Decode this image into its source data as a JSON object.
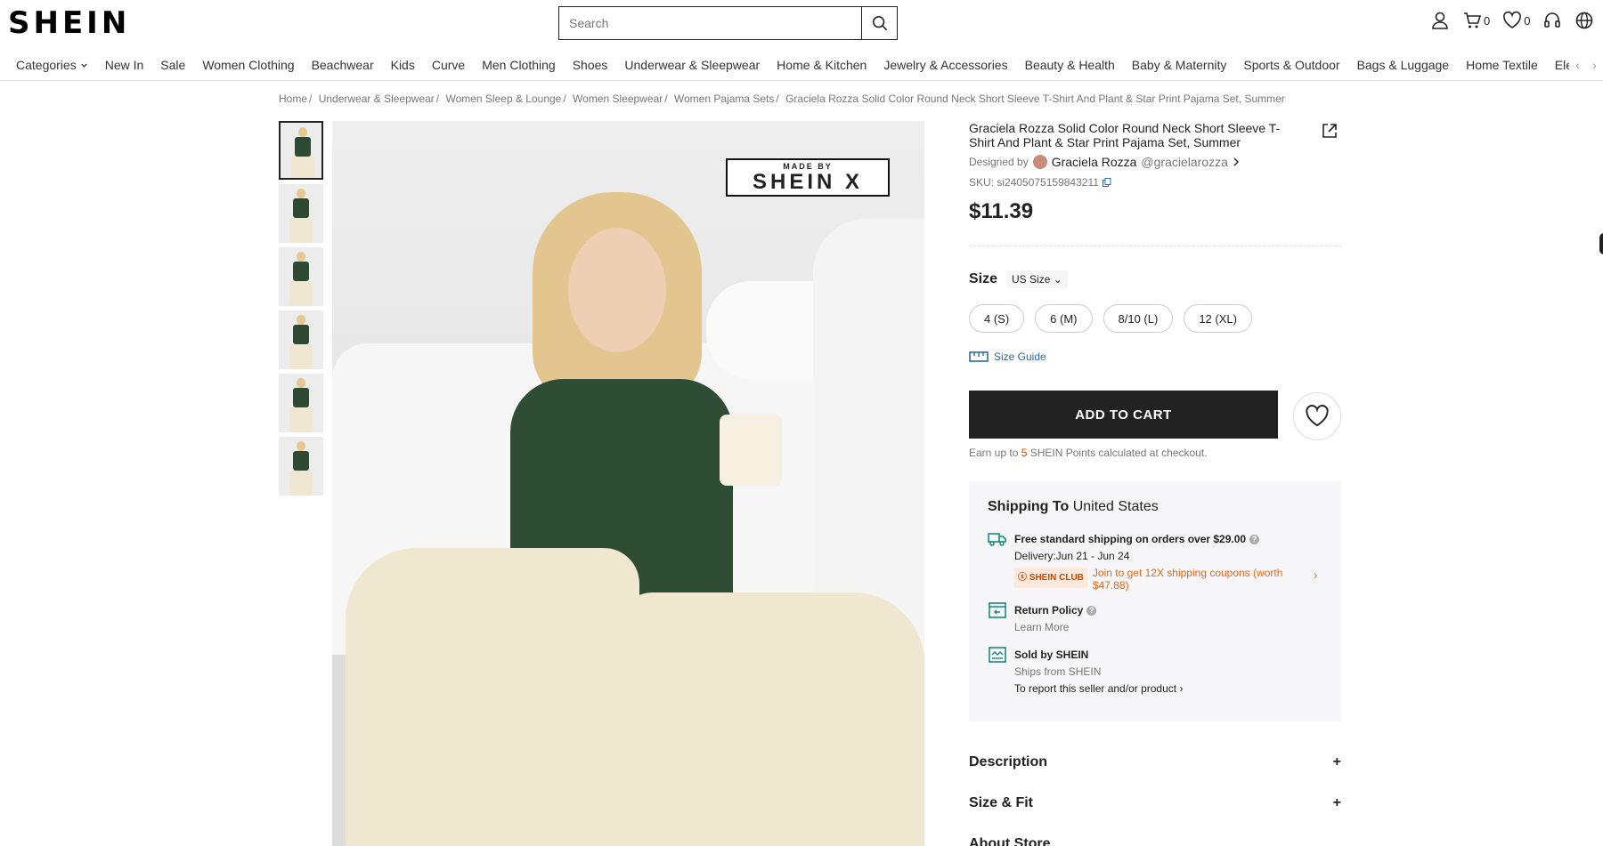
{
  "header": {
    "logo": "SHEIN",
    "search_placeholder": "Search",
    "cart_count": "0",
    "wishlist_count": "0"
  },
  "nav": {
    "items": [
      "Categories",
      "New In",
      "Sale",
      "Women Clothing",
      "Beachwear",
      "Kids",
      "Curve",
      "Men Clothing",
      "Shoes",
      "Underwear & Sleepwear",
      "Home & Kitchen",
      "Jewelry & Accessories",
      "Beauty & Health",
      "Baby & Maternity",
      "Sports & Outdoor",
      "Bags & Luggage",
      "Home Textile",
      "Electronic"
    ]
  },
  "breadcrumb": [
    "Home",
    "Underwear & Sleepwear",
    "Women Sleep & Lounge",
    "Women Sleepwear",
    "Women Pajama Sets",
    "Graciela Rozza Solid Color Round Neck Short Sleeve T-Shirt And Plant & Star Print Pajama Set, Summer"
  ],
  "gallery": {
    "thumb_count": 6,
    "badge_line1": "MADE BY",
    "badge_line2": "SHEIN X"
  },
  "product": {
    "title": "Graciela Rozza Solid Color Round Neck Short Sleeve T-Shirt And Plant & Star Print Pajama Set, Summer",
    "designed_by_label": "Designed by",
    "designer_name": "Graciela Rozza",
    "designer_handle": "@gracielarozza",
    "sku": "SKU: si2405075159843211",
    "price": "$11.39",
    "size_label": "Size",
    "size_system": "US Size",
    "sizes": [
      "4 (S)",
      "6 (M)",
      "8/10 (L)",
      "12 (XL)"
    ],
    "size_guide": "Size Guide",
    "add_to_cart": "ADD TO CART",
    "points_prefix": "Earn up to ",
    "points_value": "5",
    "points_suffix": " SHEIN Points calculated at checkout."
  },
  "shipping": {
    "title_bold": "Shipping To",
    "country": "United States",
    "free_shipping": "Free standard shipping on orders over $29.00",
    "delivery": "Delivery:Jun 21 - Jun 24",
    "club_tag": "SHEIN CLUB",
    "club_text": "Join to get 12X shipping coupons (worth $47.88)",
    "return_policy": "Return Policy",
    "learn_more": "Learn More",
    "sold_by": "Sold by SHEIN",
    "ships_from": "Ships from SHEIN",
    "report": "To report this seller and/or product"
  },
  "accordions": [
    "Description",
    "Size & Fit",
    "About Store"
  ],
  "colors": {
    "accent_orange": "#e0691a",
    "link_blue": "#2d68a8",
    "cart_black": "#222222"
  }
}
